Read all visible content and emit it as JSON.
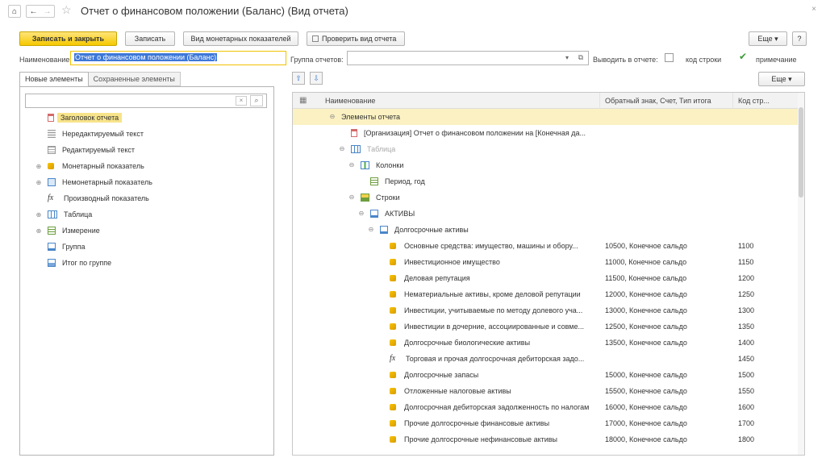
{
  "window": {
    "title": "Отчет о финансовом положении (Баланс) (Вид отчета)",
    "close_glyph": "×"
  },
  "toolbar": {
    "save_close": "Записать и закрыть",
    "save": "Записать",
    "monetary": "Вид монетарных показателей",
    "check": "Проверить вид отчета",
    "more": "Еще",
    "help": "?"
  },
  "form": {
    "name_label": "Наименование:",
    "name_value": "Отчет о финансовом положении (Баланс)",
    "group_label": "Группа отчетов:",
    "group_value": "",
    "show_label": "Выводить в отчете:",
    "code_label": "код строки",
    "note_label": "примечание",
    "code_checked": false,
    "note_checked": true
  },
  "left": {
    "tabs": [
      {
        "label": "Новые элементы"
      },
      {
        "label": "Сохраненные элементы"
      }
    ],
    "search_value": "",
    "items": [
      {
        "label": "Заголовок отчета",
        "icon": "header-icon",
        "expander": "",
        "selected": true
      },
      {
        "label": "Нередактируемый текст",
        "icon": "text-icon",
        "expander": ""
      },
      {
        "label": "Редактируемый текст",
        "icon": "edit-text-icon",
        "expander": ""
      },
      {
        "label": "Монетарный показатель",
        "icon": "coin-icon",
        "expander": "⊕"
      },
      {
        "label": "Немонетарный показатель",
        "icon": "nonmonetary-icon",
        "expander": "⊕"
      },
      {
        "label": "Производный показатель",
        "icon": "fx-icon",
        "expander": ""
      },
      {
        "label": "Таблица",
        "icon": "table-icon",
        "expander": "⊕"
      },
      {
        "label": "Измерение",
        "icon": "dimension-icon",
        "expander": "⊕"
      },
      {
        "label": "Группа",
        "icon": "group-icon",
        "expander": ""
      },
      {
        "label": "Итог по группе",
        "icon": "group-total-icon",
        "expander": ""
      }
    ]
  },
  "right": {
    "more": "Еще",
    "columns": {
      "name": "Наименование",
      "sign": "Обратный знак, Счет, Тип итога",
      "code": "Код стр..."
    },
    "rows": [
      {
        "name": "Элементы отчета",
        "sign": "",
        "code": "",
        "level": 0,
        "icon": "",
        "expander": "⊖",
        "selected": true
      },
      {
        "name": "[Организация] Отчет о финансовом положении на [Конечная да...",
        "sign": "",
        "code": "",
        "level": 1,
        "icon": "header-icon",
        "expander": ""
      },
      {
        "name": "Таблица",
        "sign": "",
        "code": "",
        "level": 1,
        "icon": "table-icon",
        "expander": "⊖",
        "grey": true
      },
      {
        "name": "Колонки",
        "sign": "",
        "code": "",
        "level": 2,
        "icon": "columns-icon",
        "expander": "⊖"
      },
      {
        "name": "Период, год",
        "sign": "",
        "code": "",
        "level": 3,
        "icon": "dimension-icon",
        "expander": ""
      },
      {
        "name": "Строки",
        "sign": "",
        "code": "",
        "level": 2,
        "icon": "rows-icon",
        "expander": "⊖"
      },
      {
        "name": "АКТИВЫ",
        "sign": "",
        "code": "",
        "level": 3,
        "icon": "group-icon",
        "expander": "⊖"
      },
      {
        "name": "Долгосрочные активы",
        "sign": "",
        "code": "",
        "level": 4,
        "icon": "group-icon",
        "expander": "⊖"
      },
      {
        "name": "Основные средства: имущество, машины и обору...",
        "sign": "10500, Конечное сальдо",
        "code": "1100",
        "level": 5,
        "icon": "coin-icon",
        "expander": ""
      },
      {
        "name": "Инвестиционное имущество",
        "sign": "11000, Конечное сальдо",
        "code": "1150",
        "level": 5,
        "icon": "coin-icon",
        "expander": ""
      },
      {
        "name": "Деловая репутация",
        "sign": "11500, Конечное сальдо",
        "code": "1200",
        "level": 5,
        "icon": "coin-icon",
        "expander": ""
      },
      {
        "name": "Нематериальные активы, кроме деловой репутации",
        "sign": "12000, Конечное сальдо",
        "code": "1250",
        "level": 5,
        "icon": "coin-icon",
        "expander": ""
      },
      {
        "name": "Инвестиции, учитываемые по методу долевого уча...",
        "sign": "13000, Конечное сальдо",
        "code": "1300",
        "level": 5,
        "icon": "coin-icon",
        "expander": ""
      },
      {
        "name": "Инвестиции в дочерние, ассоциированные и совме...",
        "sign": "12500, Конечное сальдо",
        "code": "1350",
        "level": 5,
        "icon": "coin-icon",
        "expander": ""
      },
      {
        "name": "Долгосрочные биологические активы",
        "sign": "13500, Конечное сальдо",
        "code": "1400",
        "level": 5,
        "icon": "coin-icon",
        "expander": ""
      },
      {
        "name": "Торговая и прочая долгосрочная дебиторская задо...",
        "sign": "",
        "code": "1450",
        "level": 5,
        "icon": "fx-icon",
        "expander": ""
      },
      {
        "name": "Долгосрочные запасы",
        "sign": "15000, Конечное сальдо",
        "code": "1500",
        "level": 5,
        "icon": "coin-icon",
        "expander": ""
      },
      {
        "name": "Отложенные налоговые активы",
        "sign": "15500, Конечное сальдо",
        "code": "1550",
        "level": 5,
        "icon": "coin-icon",
        "expander": ""
      },
      {
        "name": "Долгосрочная дебиторская задолженность по налогам",
        "sign": "16000, Конечное сальдо",
        "code": "1600",
        "level": 5,
        "icon": "coin-icon",
        "expander": ""
      },
      {
        "name": "Прочие долгосрочные финансовые активы",
        "sign": "17000, Конечное сальдо",
        "code": "1700",
        "level": 5,
        "icon": "coin-icon",
        "expander": ""
      },
      {
        "name": "Прочие долгосрочные нефинансовые активы",
        "sign": "18000, Конечное сальдо",
        "code": "1800",
        "level": 5,
        "icon": "coin-icon",
        "expander": ""
      }
    ]
  }
}
